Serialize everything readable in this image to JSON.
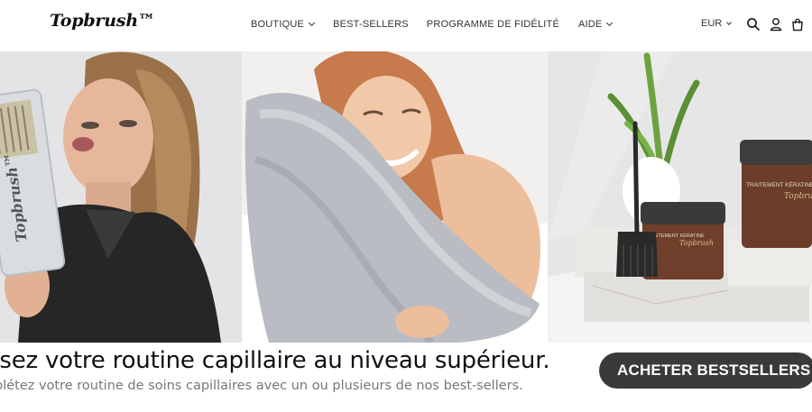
{
  "header": {
    "logo": "Topbrush™",
    "nav": {
      "boutique": "BOUTIQUE",
      "best_sellers": "BEST-SELLERS",
      "fidelite": "PROGRAMME DE FIDÉLITÉ",
      "aide": "AIDE"
    },
    "currency": "EUR",
    "icons": {
      "search": "search-icon",
      "account": "user-icon",
      "cart": "shopping-bag-icon"
    }
  },
  "hero": {
    "product_box_text": "Topbrush™",
    "jar_large_label": "TRAITEMENT KÉRATINE PURE",
    "jar_large_brand": "Topbrush",
    "jar_small_label": "TRAITEMENT KÉRATINE",
    "jar_small_brand": "Topbrush"
  },
  "banner": {
    "headline": "ssez votre routine capillaire au niveau supérieur.",
    "subline": "plétez votre routine de soins capillaires avec un ou plusieurs de nos best-sellers.",
    "cta": "ACHETER BESTSELLERS"
  },
  "colors": {
    "cta_bg": "#3a3a3a",
    "text_primary": "#111111",
    "text_secondary": "#777777"
  }
}
